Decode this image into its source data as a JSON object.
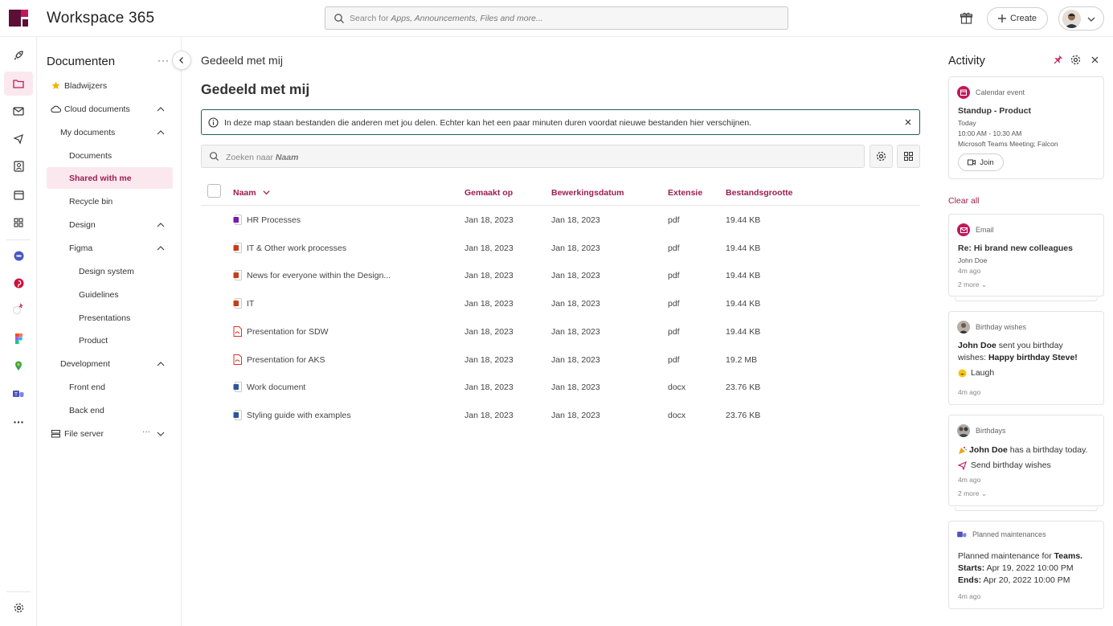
{
  "app": {
    "title": "Workspace 365",
    "brand_color": "#9c1d4f",
    "accent_color": "#c2185b"
  },
  "topbar": {
    "search_placeholder_prefix": "Search for ",
    "search_placeholder_em": "Apps, Announcements, Files and more...",
    "create_label": "Create",
    "icons": [
      "logo-icon",
      "search-icon",
      "gift-icon",
      "plus-icon",
      "avatar",
      "chevron-down-icon"
    ]
  },
  "rail": {
    "items": [
      "rocket-icon",
      "folder-icon",
      "mail-icon",
      "megaphone-icon",
      "contacts-icon",
      "calendar-icon",
      "apps-icon",
      "app-blue-icon",
      "pinterest-icon",
      "app-pinned-icon",
      "figma-icon",
      "maps-icon",
      "teams-icon",
      "more-icon",
      "settings-icon"
    ],
    "active": "folder-icon"
  },
  "docnav": {
    "title": "Documenten",
    "more": "···",
    "items": [
      {
        "label": "Bladwijzers"
      },
      {
        "label": "Cloud documents"
      },
      {
        "label": "My documents"
      },
      {
        "label": "Documents"
      },
      {
        "label": "Shared with me"
      },
      {
        "label": "Recycle bin"
      },
      {
        "label": "Design"
      },
      {
        "label": "Figma"
      },
      {
        "label": "Design system"
      },
      {
        "label": "Guidelines"
      },
      {
        "label": "Presentations"
      },
      {
        "label": "Product"
      },
      {
        "label": "Development"
      },
      {
        "label": "Front end"
      },
      {
        "label": "Back end"
      },
      {
        "label": "File server"
      }
    ],
    "file_server_more": "···"
  },
  "main": {
    "breadcrumb": "Gedeeld met mij",
    "title": "Gedeeld met mij",
    "info_text": "In deze map staan bestanden die anderen met jou delen. Echter kan het een paar minuten duren voordat nieuwe bestanden hier verschijnen.",
    "search_prefix": "Zoeken naar ",
    "search_em": "Naam",
    "columns": [
      "Naam",
      "Gemaakt op",
      "Bewerkingsdatum",
      "Extensie",
      "Bestandsgrootte"
    ],
    "rows": [
      {
        "name": "HR Processes",
        "created": "Jan 18, 2023",
        "edited": "Jan 18, 2023",
        "ext": "pdf",
        "size": "19.44 KB",
        "icon": "onenote"
      },
      {
        "name": "IT & Other work processes",
        "created": "Jan 18, 2023",
        "edited": "Jan 18, 2023",
        "ext": "pdf",
        "size": "19.44 KB",
        "icon": "powerpoint"
      },
      {
        "name": "News for everyone within the Design...",
        "created": "Jan 18, 2023",
        "edited": "Jan 18, 2023",
        "ext": "pdf",
        "size": "19.44 KB",
        "icon": "powerpoint"
      },
      {
        "name": "IT",
        "created": "Jan 18, 2023",
        "edited": "Jan 18, 2023",
        "ext": "pdf",
        "size": "19.44 KB",
        "icon": "powerpoint"
      },
      {
        "name": "Presentation for SDW",
        "created": "Jan 18, 2023",
        "edited": "Jan 18, 2023",
        "ext": "pdf",
        "size": "19.44 KB",
        "icon": "pdf"
      },
      {
        "name": "Presentation for AKS",
        "created": "Jan 18, 2023",
        "edited": "Jan 18, 2023",
        "ext": "pdf",
        "size": "19.2 MB",
        "icon": "pdf"
      },
      {
        "name": "Work document",
        "created": "Jan 18, 2023",
        "edited": "Jan 18, 2023",
        "ext": "docx",
        "size": "23.76 KB",
        "icon": "word"
      },
      {
        "name": "Styling guide with examples",
        "created": "Jan 18, 2023",
        "edited": "Jan 18, 2023",
        "ext": "docx",
        "size": "23.76 KB",
        "icon": "word"
      }
    ]
  },
  "activity": {
    "title": "Activity",
    "clear_all": "Clear all",
    "calendar": {
      "type": "Calendar event",
      "title": "Standup - Product",
      "when": "Today",
      "time": "10:00 AM - 10:30 AM",
      "location": "Microsoft Teams Meeting; Falcon",
      "join": "Join"
    },
    "email": {
      "type": "Email",
      "title": "Re: Hi brand new colleagues",
      "from": "John Doe",
      "ago": "4m ago",
      "more": "2 more"
    },
    "birthday_wishes": {
      "type": "Birthday wishes",
      "name": "John Doe",
      "line1_rest": " sent you birthday",
      "line2_prefix": "wishes: ",
      "line2_bold": "Happy birthday Steve!",
      "reaction": "Laugh",
      "ago": "4m ago"
    },
    "birthdays": {
      "type": "Birthdays",
      "name": "John Doe",
      "line1_rest": " has a birthday today.",
      "action": "Send birthday wishes",
      "ago": "4m ago",
      "more": "2 more"
    },
    "maintenance": {
      "type": "Planned maintenances",
      "line1_prefix": "Planned maintenance for ",
      "line1_bold": "Teams.",
      "starts_label": "Starts:",
      "starts": " Apr 19, 2022 10:00 PM",
      "ends_label": "Ends:",
      "ends": " Apr 20, 2022 10:00 PM",
      "ago": "4m ago"
    }
  }
}
